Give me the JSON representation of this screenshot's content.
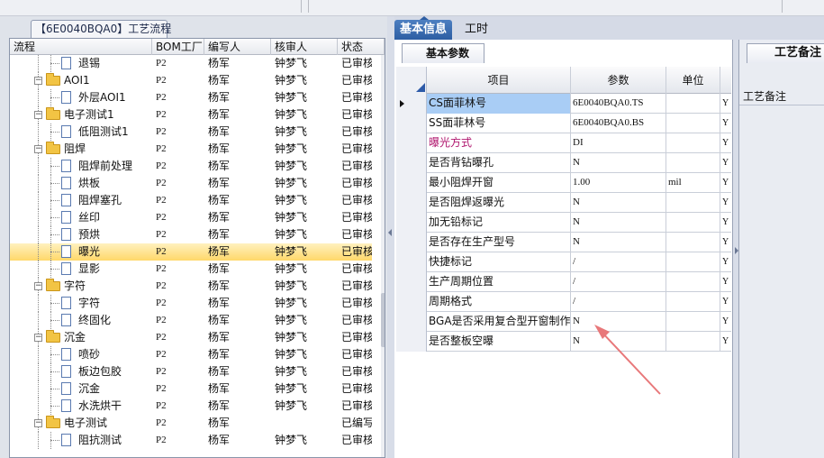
{
  "left_panel": {
    "tab_title": "【6E0040BQA0】工艺流程",
    "columns": [
      "流程",
      "BOM工厂",
      "编写人",
      "核审人",
      "状态"
    ],
    "rows": [
      {
        "level": 2,
        "kind": "doc",
        "name": "退锡",
        "bom": "P2",
        "writer": "杨军",
        "reviewer": "钟梦飞",
        "status": "已审核"
      },
      {
        "level": 1,
        "kind": "folder",
        "name": "AOI1",
        "bom": "P2",
        "writer": "杨军",
        "reviewer": "钟梦飞",
        "status": "已审核"
      },
      {
        "level": 2,
        "kind": "doc",
        "name": "外层AOI1",
        "bom": "P2",
        "writer": "杨军",
        "reviewer": "钟梦飞",
        "status": "已审核"
      },
      {
        "level": 1,
        "kind": "folder",
        "name": "电子测试1",
        "bom": "P2",
        "writer": "杨军",
        "reviewer": "钟梦飞",
        "status": "已审核"
      },
      {
        "level": 2,
        "kind": "doc",
        "name": "低阻测试1",
        "bom": "P2",
        "writer": "杨军",
        "reviewer": "钟梦飞",
        "status": "已审核"
      },
      {
        "level": 1,
        "kind": "folder",
        "name": "阻焊",
        "bom": "P2",
        "writer": "杨军",
        "reviewer": "钟梦飞",
        "status": "已审核"
      },
      {
        "level": 2,
        "kind": "doc",
        "name": "阻焊前处理",
        "bom": "P2",
        "writer": "杨军",
        "reviewer": "钟梦飞",
        "status": "已审核"
      },
      {
        "level": 2,
        "kind": "doc",
        "name": "烘板",
        "bom": "P2",
        "writer": "杨军",
        "reviewer": "钟梦飞",
        "status": "已审核"
      },
      {
        "level": 2,
        "kind": "doc",
        "name": "阻焊塞孔",
        "bom": "P2",
        "writer": "杨军",
        "reviewer": "钟梦飞",
        "status": "已审核"
      },
      {
        "level": 2,
        "kind": "doc",
        "name": "丝印",
        "bom": "P2",
        "writer": "杨军",
        "reviewer": "钟梦飞",
        "status": "已审核"
      },
      {
        "level": 2,
        "kind": "doc",
        "name": "预烘",
        "bom": "P2",
        "writer": "杨军",
        "reviewer": "钟梦飞",
        "status": "已审核"
      },
      {
        "level": 2,
        "kind": "doc",
        "name": "曝光",
        "bom": "P2",
        "writer": "杨军",
        "reviewer": "钟梦飞",
        "status": "已审核",
        "selected": true
      },
      {
        "level": 2,
        "kind": "doc",
        "name": "显影",
        "bom": "P2",
        "writer": "杨军",
        "reviewer": "钟梦飞",
        "status": "已审核"
      },
      {
        "level": 1,
        "kind": "folder",
        "name": "字符",
        "bom": "P2",
        "writer": "杨军",
        "reviewer": "钟梦飞",
        "status": "已审核"
      },
      {
        "level": 2,
        "kind": "doc",
        "name": "字符",
        "bom": "P2",
        "writer": "杨军",
        "reviewer": "钟梦飞",
        "status": "已审核"
      },
      {
        "level": 2,
        "kind": "doc",
        "name": "终固化",
        "bom": "P2",
        "writer": "杨军",
        "reviewer": "钟梦飞",
        "status": "已审核"
      },
      {
        "level": 1,
        "kind": "folder",
        "name": "沉金",
        "bom": "P2",
        "writer": "杨军",
        "reviewer": "钟梦飞",
        "status": "已审核"
      },
      {
        "level": 2,
        "kind": "doc",
        "name": "喷砂",
        "bom": "P2",
        "writer": "杨军",
        "reviewer": "钟梦飞",
        "status": "已审核"
      },
      {
        "level": 2,
        "kind": "doc",
        "name": "板边包胶",
        "bom": "P2",
        "writer": "杨军",
        "reviewer": "钟梦飞",
        "status": "已审核"
      },
      {
        "level": 2,
        "kind": "doc",
        "name": "沉金",
        "bom": "P2",
        "writer": "杨军",
        "reviewer": "钟梦飞",
        "status": "已审核"
      },
      {
        "level": 2,
        "kind": "doc",
        "name": "水洗烘干",
        "bom": "P2",
        "writer": "杨军",
        "reviewer": "钟梦飞",
        "status": "已审核"
      },
      {
        "level": 1,
        "kind": "folder",
        "name": "电子测试",
        "bom": "P2",
        "writer": "杨军",
        "reviewer": "",
        "status": "已编写"
      },
      {
        "level": 2,
        "kind": "doc",
        "name": "阻抗测试",
        "bom": "P2",
        "writer": "杨军",
        "reviewer": "钟梦飞",
        "status": "已审核"
      }
    ]
  },
  "right_panel": {
    "tabs": [
      "基本信息",
      "工时"
    ],
    "active_tab": "基本信息",
    "sub_tab": "基本参数",
    "grid_headers": {
      "item": "项目",
      "value": "参数",
      "unit": "单位"
    },
    "params": [
      {
        "item": "CS面菲林号",
        "value": "6E0040BQA0.TS",
        "unit": "",
        "flag": "Y",
        "current": true
      },
      {
        "item": "SS面菲林号",
        "value": "6E0040BQA0.BS",
        "unit": "",
        "flag": "Y"
      },
      {
        "item": "曝光方式",
        "value": "DI",
        "unit": "",
        "flag": "Y",
        "highlight": "#b0166e"
      },
      {
        "item": "是否背钻曝孔",
        "value": "N",
        "unit": "",
        "flag": "Y"
      },
      {
        "item": "最小阻焊开窗",
        "value": "1.00",
        "unit": "mil",
        "flag": "Y"
      },
      {
        "item": "是否阻焊返曝光",
        "value": "N",
        "unit": "",
        "flag": "Y"
      },
      {
        "item": "加无铅标记",
        "value": "N",
        "unit": "",
        "flag": "Y"
      },
      {
        "item": "是否存在生产型号",
        "value": "N",
        "unit": "",
        "flag": "Y"
      },
      {
        "item": "快捷标记",
        "value": "/",
        "unit": "",
        "flag": "Y"
      },
      {
        "item": "生产周期位置",
        "value": "/",
        "unit": "",
        "flag": "Y"
      },
      {
        "item": "周期格式",
        "value": "/",
        "unit": "",
        "flag": "Y"
      },
      {
        "item": "BGA是否采用复合型开窗制作",
        "value": "N",
        "unit": "",
        "flag": "Y"
      },
      {
        "item": "是否整板空曝",
        "value": "N",
        "unit": "",
        "flag": "Y"
      }
    ],
    "note_tab": "工艺备注",
    "note_label": "工艺备注"
  },
  "colors": {
    "selection_row": "#ffd86a",
    "active_tab": "#2d5ea3",
    "current_cell": "#a9cdf5",
    "annotation_arrow": "#e8787a"
  }
}
